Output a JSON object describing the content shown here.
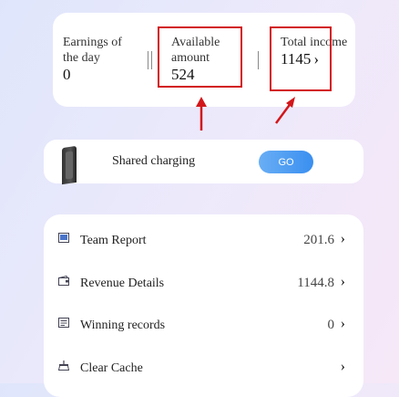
{
  "stats": {
    "earnings_day": {
      "label": "Earnings of the day",
      "value": "0"
    },
    "available": {
      "label": "Available amount",
      "value": "524"
    },
    "total": {
      "label": "Total income",
      "value": "1145",
      "chevron": "›"
    }
  },
  "charging": {
    "label": "Shared charging",
    "button": "GO"
  },
  "menu": {
    "items": [
      {
        "label": "Team Report",
        "value": "201.6",
        "icon": "report-icon"
      },
      {
        "label": "Revenue Details",
        "value": "1144.8",
        "icon": "wallet-icon"
      },
      {
        "label": "Winning records",
        "value": "0",
        "icon": "records-icon"
      },
      {
        "label": "Clear Cache",
        "value": "",
        "icon": "broom-icon"
      }
    ],
    "chevron": "›"
  },
  "colors": {
    "highlight": "#d2171b",
    "go_button": "#3a8ff0"
  }
}
